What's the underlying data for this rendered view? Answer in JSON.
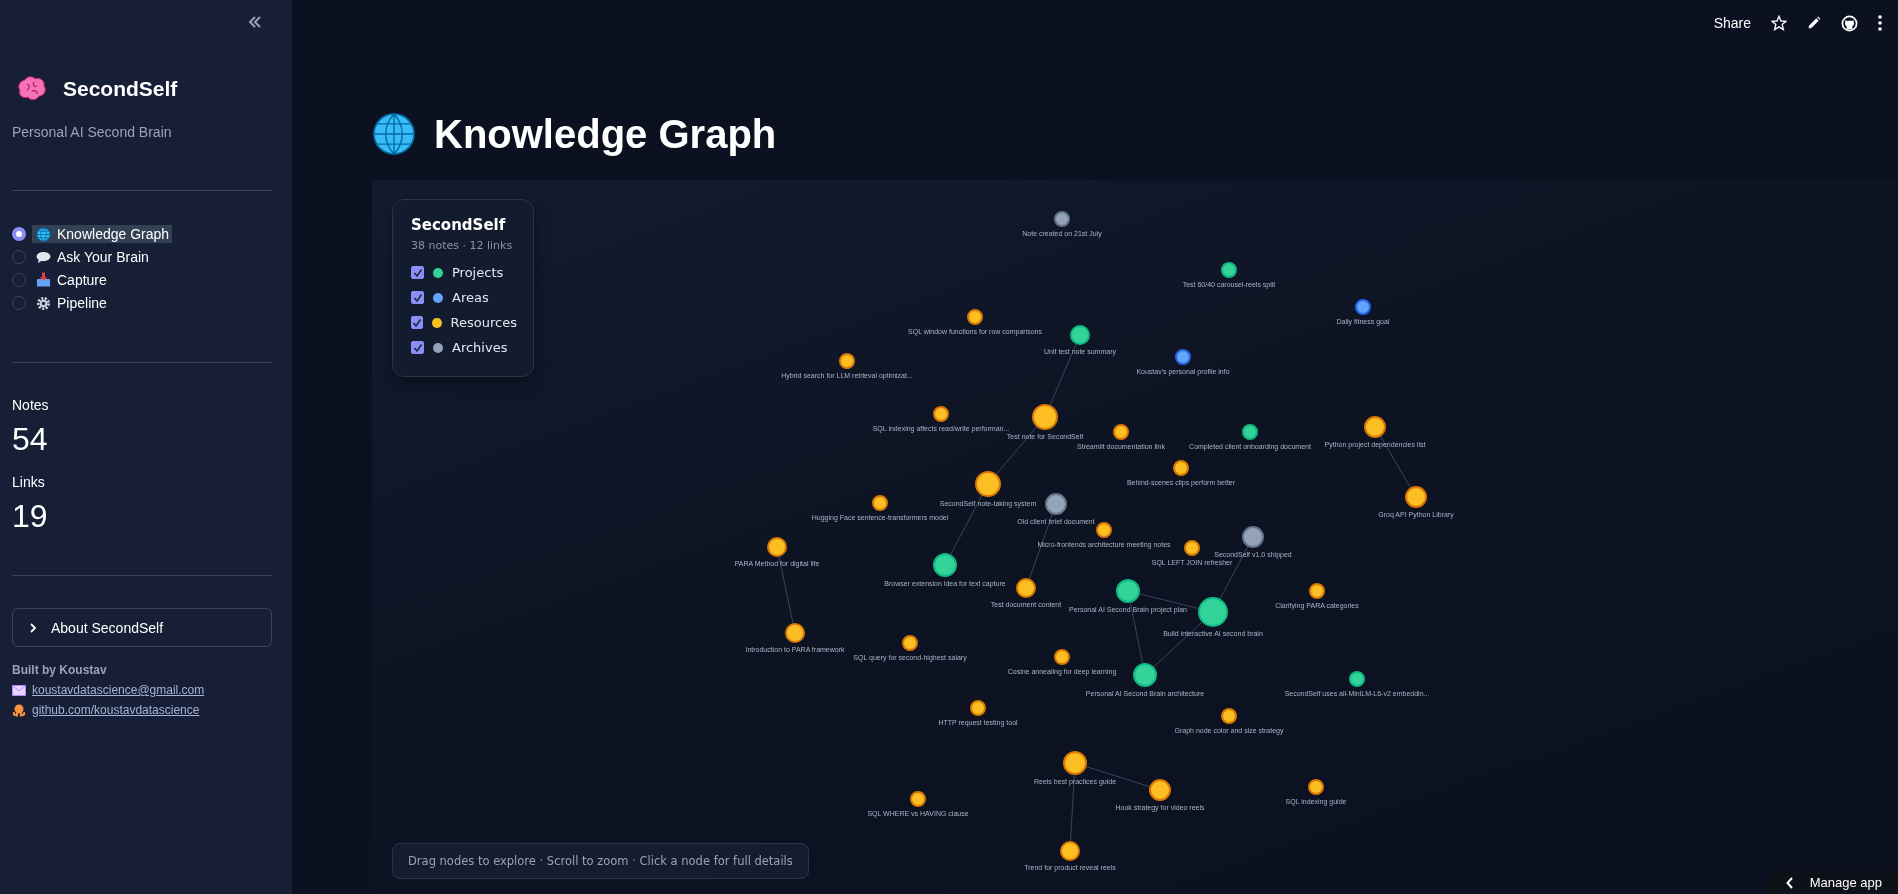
{
  "sidebar": {
    "brand": {
      "title": "SecondSelf",
      "subtitle": "Personal AI Second Brain"
    },
    "nav": [
      {
        "label": "Knowledge Graph",
        "selected": true
      },
      {
        "label": "Ask Your Brain",
        "selected": false
      },
      {
        "label": "Capture",
        "selected": false
      },
      {
        "label": "Pipeline",
        "selected": false
      }
    ],
    "stats": [
      {
        "label": "Notes",
        "value": "54"
      },
      {
        "label": "Links",
        "value": "19"
      }
    ],
    "about": {
      "label": "About SecondSelf",
      "expanded": false
    },
    "built_by": "Built by Koustav",
    "contacts": [
      {
        "kind": "email",
        "label": "koustavdatascience@gmail.com"
      },
      {
        "kind": "github",
        "label": "github.com/koustavdatascience"
      }
    ]
  },
  "toolbar": {
    "share": "Share"
  },
  "page": {
    "title": "Knowledge Graph"
  },
  "graph": {
    "legend": {
      "title": "SecondSelf",
      "subtitle": "38 notes · 12 links",
      "categories": [
        {
          "kind": "project",
          "label": "Projects",
          "checked": true,
          "color": "#34d399"
        },
        {
          "kind": "area",
          "label": "Areas",
          "checked": true,
          "color": "#60a5fa"
        },
        {
          "kind": "resource",
          "label": "Resources",
          "checked": true,
          "color": "#fbbf24"
        },
        {
          "kind": "archive",
          "label": "Archives",
          "checked": true,
          "color": "#94a3b8"
        }
      ]
    },
    "nodes": [
      {
        "label": "Note created on 21st July",
        "kind": "archive"
      },
      {
        "label": "Test 60/40 carousel-reels split",
        "kind": "project"
      },
      {
        "label": "Daily fitness goal",
        "kind": "area"
      },
      {
        "label": "SQL window functions for row comparisons",
        "kind": "resource"
      },
      {
        "label": "Unit test note summary",
        "kind": "project"
      },
      {
        "label": "Koustav's personal profile info",
        "kind": "area"
      },
      {
        "label": "Hybrid search for LLM retrieval optimizat...",
        "kind": "resource"
      },
      {
        "label": "SQL indexing affects read/write performan...",
        "kind": "resource"
      },
      {
        "label": "Test note for SecondSelf",
        "kind": "resource"
      },
      {
        "label": "Streamlit documentation link",
        "kind": "resource"
      },
      {
        "label": "Completed client onboarding document",
        "kind": "project"
      },
      {
        "label": "Python project dependencies list",
        "kind": "resource"
      },
      {
        "label": "Behind-scenes clips perform better",
        "kind": "resource"
      },
      {
        "label": "SecondSelf note-taking system",
        "kind": "resource"
      },
      {
        "label": "Groq API Python Library",
        "kind": "resource"
      },
      {
        "label": "Hugging Face sentence-transformers model",
        "kind": "resource"
      },
      {
        "label": "Old client brief document",
        "kind": "archive"
      },
      {
        "label": "Micro-frontends architecture meeting notes",
        "kind": "resource"
      },
      {
        "label": "SQL LEFT JOIN refresher",
        "kind": "resource"
      },
      {
        "label": "SecondSelf v1.0 shipped",
        "kind": "archive"
      },
      {
        "label": "PARA Method for digital life",
        "kind": "resource"
      },
      {
        "label": "Browser extension idea for text capture",
        "kind": "project"
      },
      {
        "label": "Test document content",
        "kind": "resource"
      },
      {
        "label": "Personal AI Second Brain project plan",
        "kind": "project"
      },
      {
        "label": "Build interactive AI second brain",
        "kind": "project"
      },
      {
        "label": "Clarifying PARA categories",
        "kind": "resource"
      },
      {
        "label": "Introduction to PARA framework",
        "kind": "resource"
      },
      {
        "label": "SQL query for second-highest salary",
        "kind": "resource"
      },
      {
        "label": "Cosine annealing for deep learning",
        "kind": "resource"
      },
      {
        "label": "Personal AI Second Brain architecture",
        "kind": "project"
      },
      {
        "label": "SecondSelf uses all-MiniLM-L6-v2 embeddin...",
        "kind": "project"
      },
      {
        "label": "HTTP request testing tool",
        "kind": "resource"
      },
      {
        "label": "Graph node color and size strategy",
        "kind": "resource"
      },
      {
        "label": "Reels best practices guide",
        "kind": "resource"
      },
      {
        "label": "Hook strategy for video reels",
        "kind": "resource"
      },
      {
        "label": "SQL indexing guide",
        "kind": "resource"
      },
      {
        "label": "SQL WHERE vs HAVING clause",
        "kind": "resource"
      },
      {
        "label": "Trend for product reveal reels",
        "kind": "resource"
      }
    ],
    "hint": "Drag nodes to explore · Scroll to zoom · Click a node for full details"
  },
  "manage_app": "Manage app"
}
